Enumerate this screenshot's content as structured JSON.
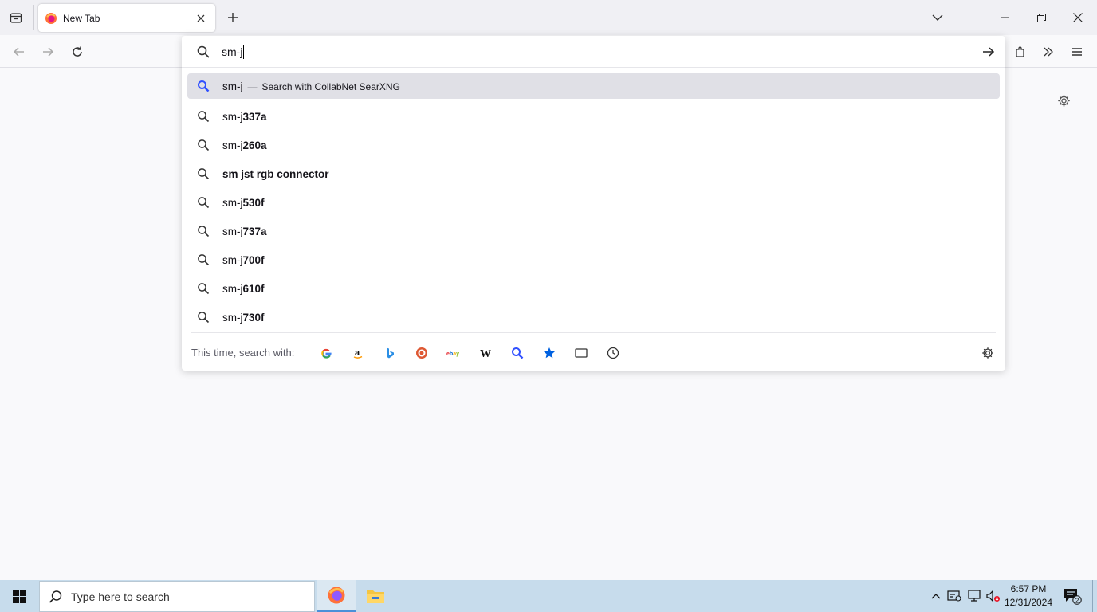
{
  "tab": {
    "title": "New Tab"
  },
  "urlbar": {
    "value": "sm-j"
  },
  "results": [
    {
      "type": "search-action",
      "query": "sm-j",
      "separator": "—",
      "action": "Search with CollabNet SearXNG"
    },
    {
      "prefix": "sm-j",
      "suffix": "337a"
    },
    {
      "prefix": "sm-j",
      "suffix": "260a"
    },
    {
      "prefix": "",
      "suffix": "sm jst rgb connector"
    },
    {
      "prefix": "sm-j",
      "suffix": "530f"
    },
    {
      "prefix": "sm-j",
      "suffix": "737a"
    },
    {
      "prefix": "sm-j",
      "suffix": "700f"
    },
    {
      "prefix": "sm-j",
      "suffix": "610f"
    },
    {
      "prefix": "sm-j",
      "suffix": "730f"
    }
  ],
  "oneoff": {
    "label": "This time, search with:",
    "engines": [
      "google-icon",
      "amazon-icon",
      "bing-icon",
      "duckduckgo-icon",
      "ebay-icon",
      "wikipedia-icon",
      "searxng-icon",
      "bookmarks-icon",
      "tabs-icon",
      "history-icon"
    ]
  },
  "taskbar": {
    "search_placeholder": "Type here to search",
    "time": "6:57 PM",
    "date": "12/31/2024",
    "notification_count": "2"
  },
  "colors": {
    "accent": "#0061e0",
    "popup_active_row": "#e0e0e6",
    "taskbar": "#c7dcec"
  }
}
